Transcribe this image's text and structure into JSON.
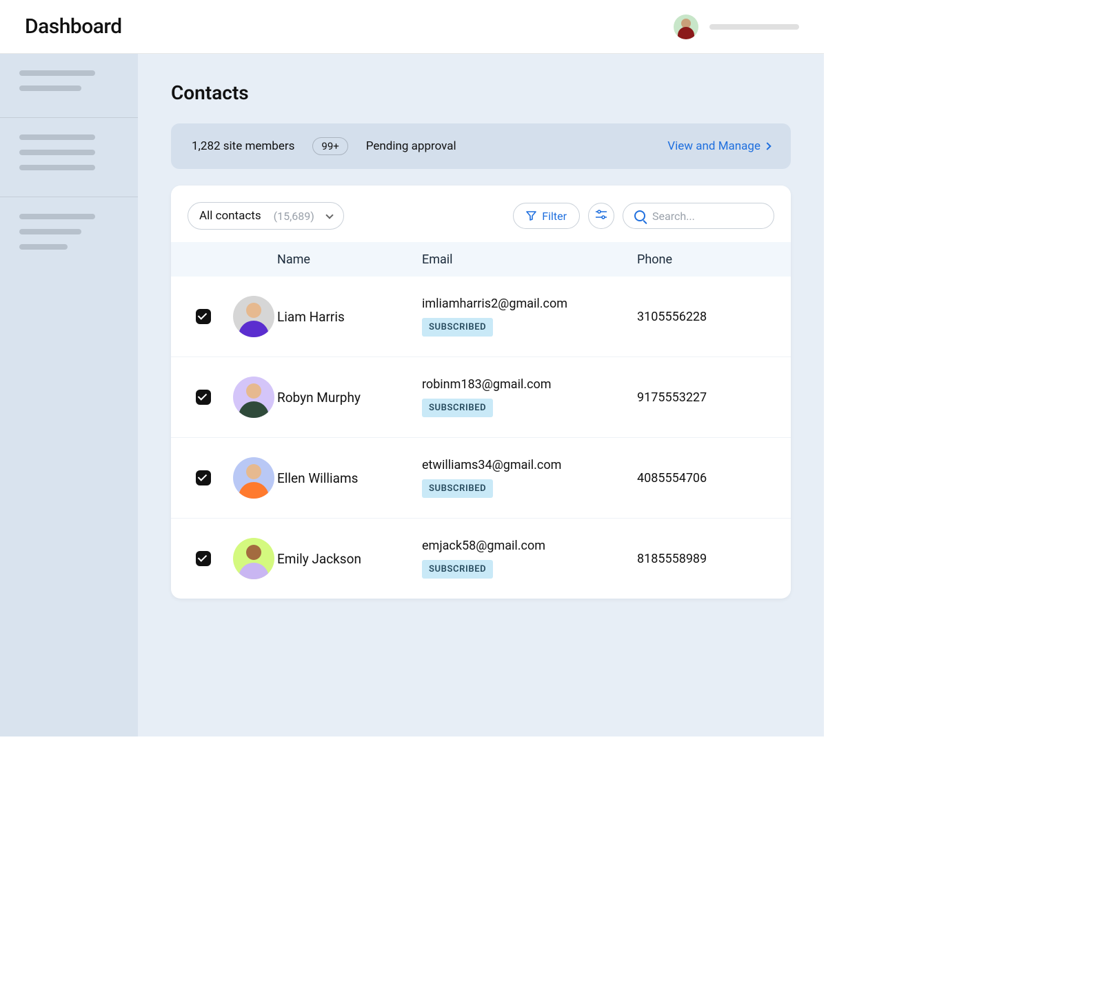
{
  "header": {
    "brand": "Dashboard"
  },
  "page": {
    "title": "Contacts"
  },
  "banner": {
    "members_text": "1,282 site members",
    "badge": "99+",
    "pending_label": "Pending approval",
    "cta": "View and Manage"
  },
  "toolbar": {
    "segment_label": "All contacts",
    "segment_count": "(15,689)",
    "filter_label": "Filter",
    "search_placeholder": "Search..."
  },
  "table": {
    "columns": {
      "name": "Name",
      "email": "Email",
      "phone": "Phone"
    },
    "badge_label": "SUBSCRIBED",
    "rows": [
      {
        "name": "Liam Harris",
        "email": "imliamharris2@gmail.com",
        "phone": "3105556228",
        "checked": true,
        "subscribed": true
      },
      {
        "name": "Robyn Murphy",
        "email": "robinm183@gmail.com",
        "phone": "9175553227",
        "checked": true,
        "subscribed": true
      },
      {
        "name": "Ellen Williams",
        "email": "etwilliams34@gmail.com",
        "phone": "4085554706",
        "checked": true,
        "subscribed": true
      },
      {
        "name": "Emily Jackson",
        "email": "emjack58@gmail.com",
        "phone": "8185558989",
        "checked": true,
        "subscribed": true
      }
    ]
  }
}
